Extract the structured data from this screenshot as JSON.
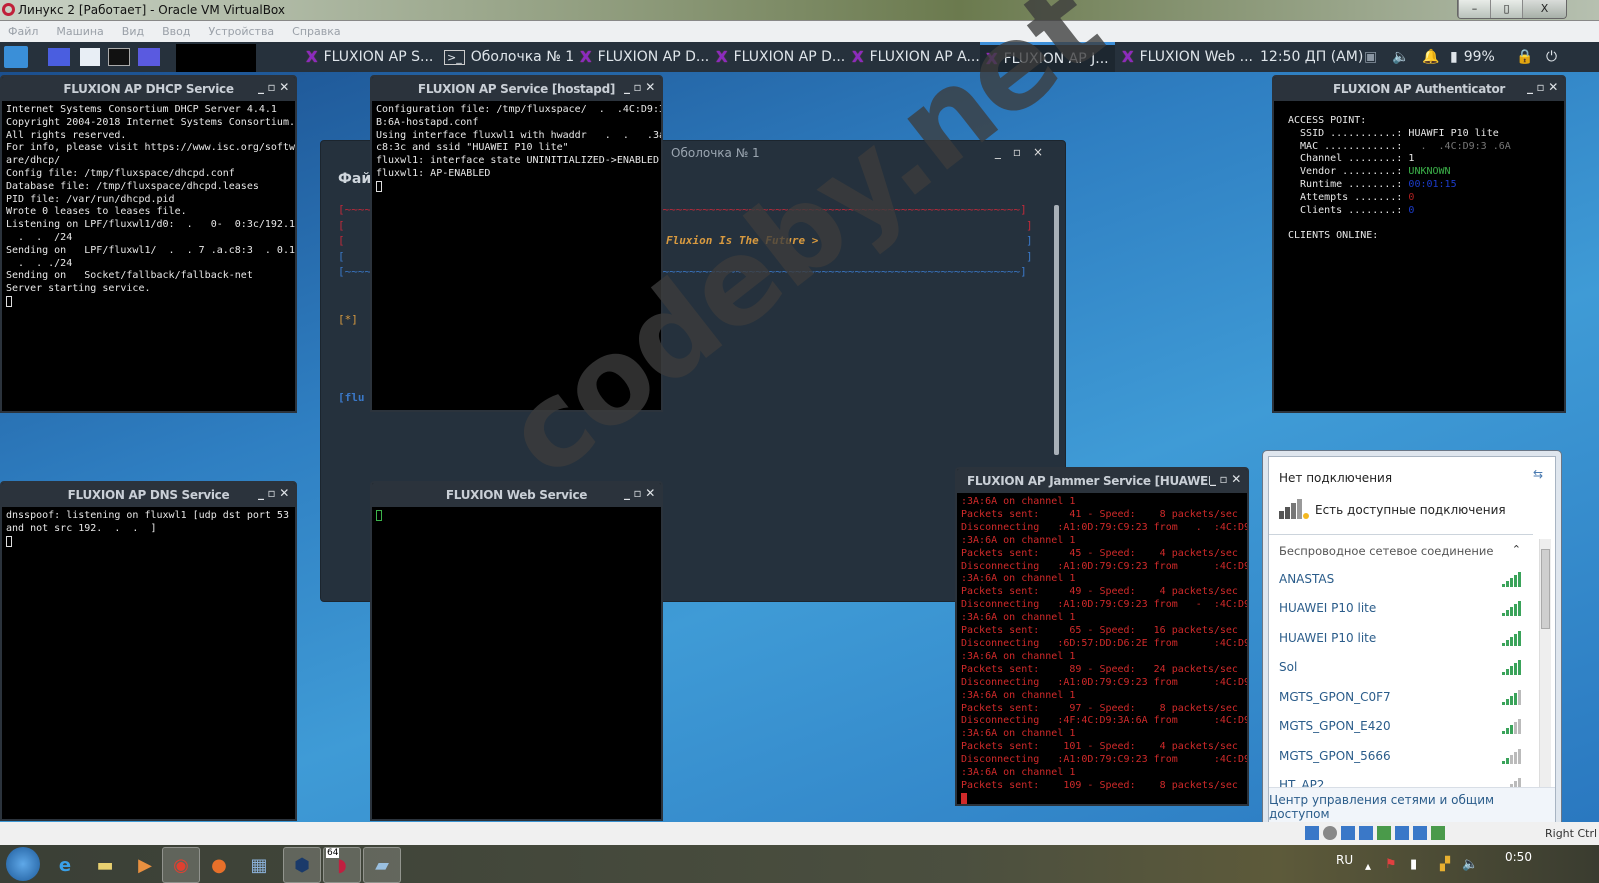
{
  "host": {
    "title": "Линукс  2 [Работает] - Oracle VM VirtualBox",
    "buttons": [
      "–",
      "▯",
      "X"
    ],
    "menu": [
      "Файл",
      "Машина",
      "Вид",
      "Ввод",
      "Устройства",
      "Справка"
    ]
  },
  "panel": {
    "tasks": [
      "FLUXION AP S...",
      "Оболочка № 1",
      "FLUXION AP D...",
      "FLUXION AP D...",
      "FLUXION AP A...",
      "FLUXION AP J...",
      "FLUXION Web ..."
    ],
    "clock": "12:50 ДП (AM)",
    "battery": "99%"
  },
  "dhcp": {
    "title": "FLUXION AP DHCP Service",
    "lines": [
      "Internet Systems Consortium DHCP Server 4.4.1",
      "Copyright 2004-2018 Internet Systems Consortium.",
      "All rights reserved.",
      "For info, please visit https://www.isc.org/softw",
      "are/dhcp/",
      "Config file: /tmp/fluxspace/dhcpd.conf",
      "Database file: /tmp/fluxspace/dhcpd.leases",
      "PID file: /var/run/dhcpd.pid",
      "Wrote 0 leases to leases file.",
      "Listening on LPF/fluxwl1/d0:  .   0-  0:3c/192.1",
      "  .  .  /24",
      "Sending on   LPF/fluxwl1/  .  . 7 .a.c8:3  . 0.1",
      "  .  . ./24",
      "Sending on   Socket/fallback/fallback-net",
      "Server starting service."
    ]
  },
  "hostapd": {
    "title": "FLUXION AP Service [hostapd]",
    "lines": [
      "Configuration file: /tmp/fluxspace/  .  .4C:D9:3",
      "B:6A-hostapd.conf",
      "Using interface fluxwl1 with hwaddr   .  .   .3a:",
      "c8:3c and ssid \"HUAWEI P10 lite\"",
      "fluxwl1: interface state UNINITIALIZED->ENABLED",
      "fluxwl1: AP-ENABLED"
    ]
  },
  "shell": {
    "title": "Оболочка № 1",
    "menu_first": "Файл",
    "banner": "Fluxion Is The Future >",
    "star": "[*]",
    "prompt": "[flu"
  },
  "auth": {
    "title": "FLUXION AP Authenticator",
    "header": "ACCESS POINT:",
    "rows": [
      {
        "label": "  SSID ...........: ",
        "value": "HUAWFI P10 lite",
        "color": "#e8e8e8"
      },
      {
        "label": "  MAC ............: ",
        "value": "  .  .4C:D9:3 .6A",
        "color": "#777"
      },
      {
        "label": "  Channel ........: ",
        "value": "1",
        "color": "#e8e8e8"
      },
      {
        "label": "  Vendor .........: ",
        "value": "UNKNOWN",
        "color": "#3cb34a"
      },
      {
        "label": "  Runtime ........: ",
        "value": "00:01:15",
        "color": "#1c3ccc"
      },
      {
        "label": "  Attempts .......: ",
        "value": "0",
        "color": "#b02020"
      },
      {
        "label": "  Clients ........: ",
        "value": "0",
        "color": "#1c3ccc"
      }
    ],
    "clients": "CLIENTS ONLINE:"
  },
  "dns": {
    "title": "FLUXION AP DNS Service",
    "lines": [
      "dnsspoof: listening on fluxwl1 [udp dst port 53",
      "and not src 192.  .  .  ]"
    ]
  },
  "web": {
    "title": "FLUXION Web Service"
  },
  "jammer": {
    "title": "FLUXION AP Jammer Service [HUAWEI I",
    "lines": [
      ":3A:6A on channel 1",
      "Packets sent:     41 - Speed:    8 packets/sec",
      "Disconnecting   :A1:0D:79:C9:23 from   .  :4C:D9",
      ":3A:6A on channel 1",
      "Packets sent:     45 - Speed:    4 packets/sec",
      "Disconnecting   :A1:0D:79:C9:23 from      :4C:D9",
      ":3A:6A on channel 1",
      "Packets sent:     49 - Speed:    4 packets/sec",
      "Disconnecting   :A1:0D:79:C9:23 from   -  :4C:D9",
      ":3A:6A on channel 1",
      "Packets sent:     65 - Speed:   16 packets/sec",
      "Disconnecting   :6D:57:DD:D6:2E from      :4C:D9",
      ":3A:6A on channel 1",
      "Packets sent:     89 - Speed:   24 packets/sec",
      "Disconnecting   :A1:0D:79:C9:23 from      :4C:D9",
      ":3A:6A on channel 1",
      "Packets sent:     97 - Speed:    8 packets/sec",
      "Disconnecting   :4F:4C:D9:3A:6A from      :4C:D9",
      ":3A:6A on channel 1",
      "Packets sent:    101 - Speed:    4 packets/sec",
      "Disconnecting   :A1:0D:79:C9:23 from      :4C:D9",
      ":3A:6A on channel 1",
      "Packets sent:    109 - Speed:    8 packets/sec"
    ]
  },
  "watermark": "codeby.net",
  "wifi": {
    "status": "Нет подключения",
    "available": "Есть доступные подключения",
    "section": "Беспроводное сетевое соединение",
    "networks": [
      {
        "name": "ANASTAS",
        "signal": 5
      },
      {
        "name": "HUAWEI P10 lite",
        "signal": 5
      },
      {
        "name": "HUAWEI P10 lite",
        "signal": 5,
        "shield": true
      },
      {
        "name": "Sol",
        "signal": 5
      },
      {
        "name": "MGTS_GPON_C0F7",
        "signal": 4
      },
      {
        "name": "MGTS_GPON_E420",
        "signal": 3
      },
      {
        "name": "MGTS_GPON_5666",
        "signal": 2
      },
      {
        "name": "HT_AP2",
        "signal": 1
      }
    ],
    "footer": "Центр управления сетями и общим доступом"
  },
  "vbstatus": {
    "hostkey": "Right Ctrl"
  },
  "taskbar": {
    "lang": "RU",
    "time": "0:50",
    "badge": "64"
  }
}
